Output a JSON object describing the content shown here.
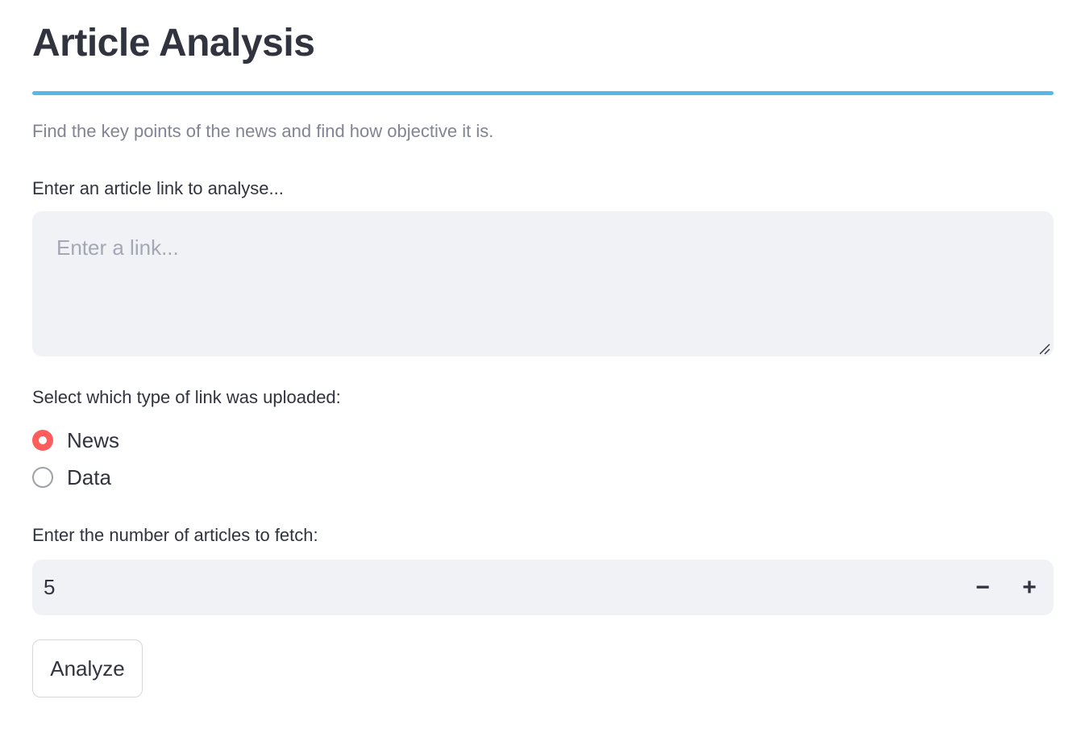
{
  "header": {
    "title": "Article Analysis",
    "caption": "Find the key points of the news and find how objective it is.",
    "accent_color": "#57b8e8"
  },
  "link_input": {
    "label": "Enter an article link to analyse...",
    "placeholder": "Enter a link...",
    "value": ""
  },
  "link_type": {
    "label": "Select which type of link was uploaded:",
    "options": [
      {
        "label": "News",
        "selected": true
      },
      {
        "label": "Data",
        "selected": false
      }
    ],
    "selected_color": "#ff4b4b"
  },
  "article_count": {
    "label": "Enter the number of articles to fetch:",
    "value": "5",
    "decrement_symbol": "−",
    "increment_symbol": "+"
  },
  "actions": {
    "analyze_label": "Analyze"
  }
}
